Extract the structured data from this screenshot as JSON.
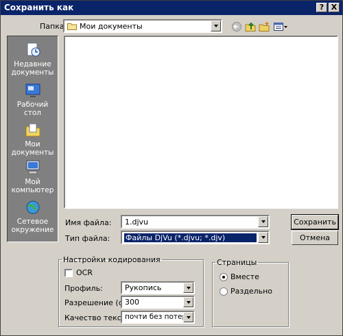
{
  "window": {
    "title": "Сохранить как",
    "help_btn": "?",
    "close_btn": "X"
  },
  "toolbar": {
    "folder_label": "Папка:",
    "folder_value": "Мои документы"
  },
  "places": [
    {
      "label": "Недавние документы"
    },
    {
      "label": "Рабочий стол"
    },
    {
      "label": "Мои документы"
    },
    {
      "label": "Мой компьютер"
    },
    {
      "label": "Сетевое окружение"
    }
  ],
  "file": {
    "name_label": "Имя файла:",
    "name_value": "1.djvu",
    "type_label": "Тип файла:",
    "type_value": "Файлы DjVu (*.djvu; *.djv)",
    "save_button": "Сохранить",
    "cancel_button": "Отмена"
  },
  "encoding": {
    "legend": "Настройки кодирования",
    "ocr_label": "OCR",
    "ocr_checked": false,
    "profile_label": "Профиль:",
    "profile_value": "Рукопись",
    "resolution_label": "Разрешение (dpi):",
    "resolution_value": "300",
    "quality_label": "Качество текста:",
    "quality_value": "почти без потерь"
  },
  "pages": {
    "legend": "Страницы",
    "option_together": "Вместе",
    "option_separate": "Раздельно",
    "selected": "together"
  }
}
